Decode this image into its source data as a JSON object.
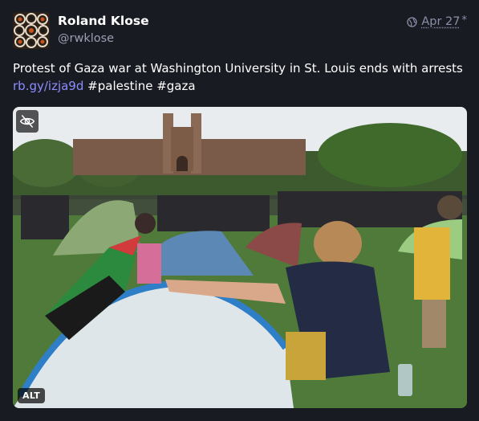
{
  "author": {
    "display_name": "Roland Klose",
    "handle": "@rwklose"
  },
  "post": {
    "visibility_icon": "globe-icon",
    "date": "Apr 27",
    "edited_mark": "*",
    "text": "Protest of Gaza war at Washington University in St. Louis ends with arrests",
    "link_text": "rb.gy/izja9d",
    "hashtags": [
      "#palestine",
      "#gaza"
    ]
  },
  "media": {
    "hide_icon": "eye-slash-icon",
    "alt_badge": "ALT"
  },
  "colors": {
    "background": "#191b22",
    "link": "#8c8dff",
    "muted": "#8c8faa"
  }
}
